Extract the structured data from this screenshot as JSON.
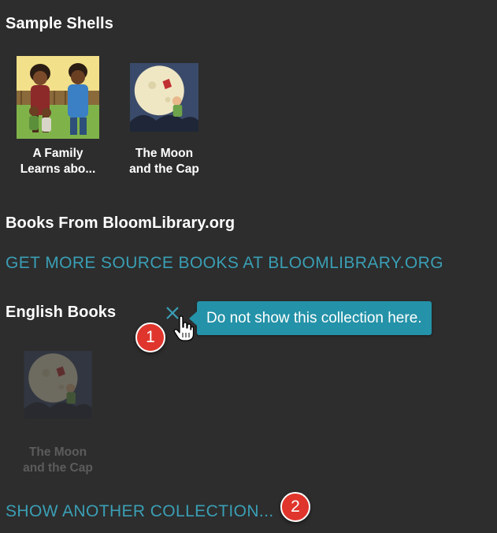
{
  "sample_shells": {
    "heading": "Sample Shells",
    "books": [
      {
        "title": "A Family\nLearns abo...",
        "thumbnail": "family-illustration"
      },
      {
        "title": "The Moon\nand the Cap",
        "thumbnail": "moon-illustration"
      }
    ]
  },
  "bloom_library": {
    "heading": "Books From BloomLibrary.org",
    "link": "GET MORE SOURCE BOOKS AT BLOOMLIBRARY.ORG"
  },
  "english_books": {
    "heading": "English Books",
    "close_icon": "close-icon",
    "tooltip": "Do not show this collection here.",
    "books": [
      {
        "title": "The Moon\nand the Cap",
        "thumbnail": "moon-illustration"
      }
    ]
  },
  "show_another": {
    "link": "SHOW ANOTHER COLLECTION..."
  },
  "callouts": [
    "1",
    "2"
  ],
  "colors": {
    "background": "#2d2d2d",
    "link": "#3a9fb5",
    "tooltip": "#2492a8",
    "callout": "#e0352c"
  }
}
